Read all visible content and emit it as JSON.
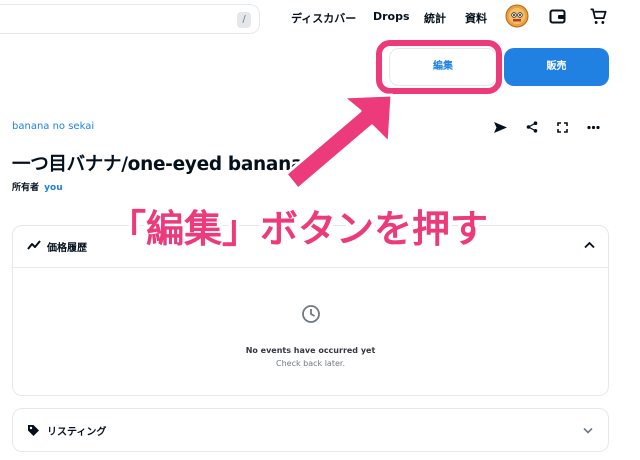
{
  "header": {
    "search_shortcut": "/",
    "nav": [
      "ディスカバー",
      "Drops",
      "統計",
      "資料"
    ]
  },
  "actions": {
    "edit_label": "編集",
    "sell_label": "販売"
  },
  "item": {
    "collection": "banana no sekai",
    "title": "一つ目バナナ/one-eyed banana",
    "owner_label": "所有者",
    "owner_name": "you"
  },
  "price_history": {
    "title": "価格履歴",
    "empty_title": "No events have occurred yet",
    "empty_subtitle": "Check back later."
  },
  "listing": {
    "title": "リスティング"
  },
  "annotation": {
    "text": "「編集」ボタンを押す"
  },
  "colors": {
    "accent": "#2081e2",
    "highlight": "#ec3a7a",
    "border": "#e5e8eb"
  },
  "icons": [
    "send-icon",
    "share-icon",
    "fullscreen-icon",
    "more-icon",
    "chart-line-icon",
    "clock-icon",
    "tag-icon",
    "chevron-down-icon",
    "chevron-up-icon",
    "wallet-icon",
    "cart-icon",
    "avatar"
  ]
}
